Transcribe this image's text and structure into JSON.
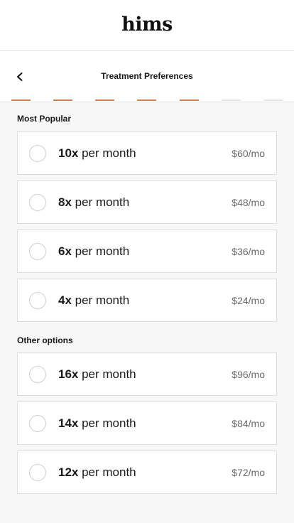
{
  "brand": {
    "logo_text": "hims"
  },
  "nav": {
    "title": "Treatment Preferences",
    "back_icon": "chevron-left-icon"
  },
  "progress": {
    "total_steps": 7,
    "completed_steps": 5,
    "active_color": "#c9825c",
    "inactive_color": "#e6e6e6"
  },
  "sections": [
    {
      "label": "Most Popular",
      "options": [
        {
          "qty": "10x",
          "unit": " per month",
          "price": "$60/mo",
          "selected": false
        },
        {
          "qty": "8x",
          "unit": " per month",
          "price": "$48/mo",
          "selected": false
        },
        {
          "qty": "6x",
          "unit": " per month",
          "price": "$36/mo",
          "selected": false
        },
        {
          "qty": "4x",
          "unit": " per month",
          "price": "$24/mo",
          "selected": false
        }
      ]
    },
    {
      "label": "Other options",
      "options": [
        {
          "qty": "16x",
          "unit": " per month",
          "price": "$96/mo",
          "selected": false
        },
        {
          "qty": "14x",
          "unit": " per month",
          "price": "$84/mo",
          "selected": false
        },
        {
          "qty": "12x",
          "unit": " per month",
          "price": "$72/mo",
          "selected": false
        }
      ]
    }
  ]
}
